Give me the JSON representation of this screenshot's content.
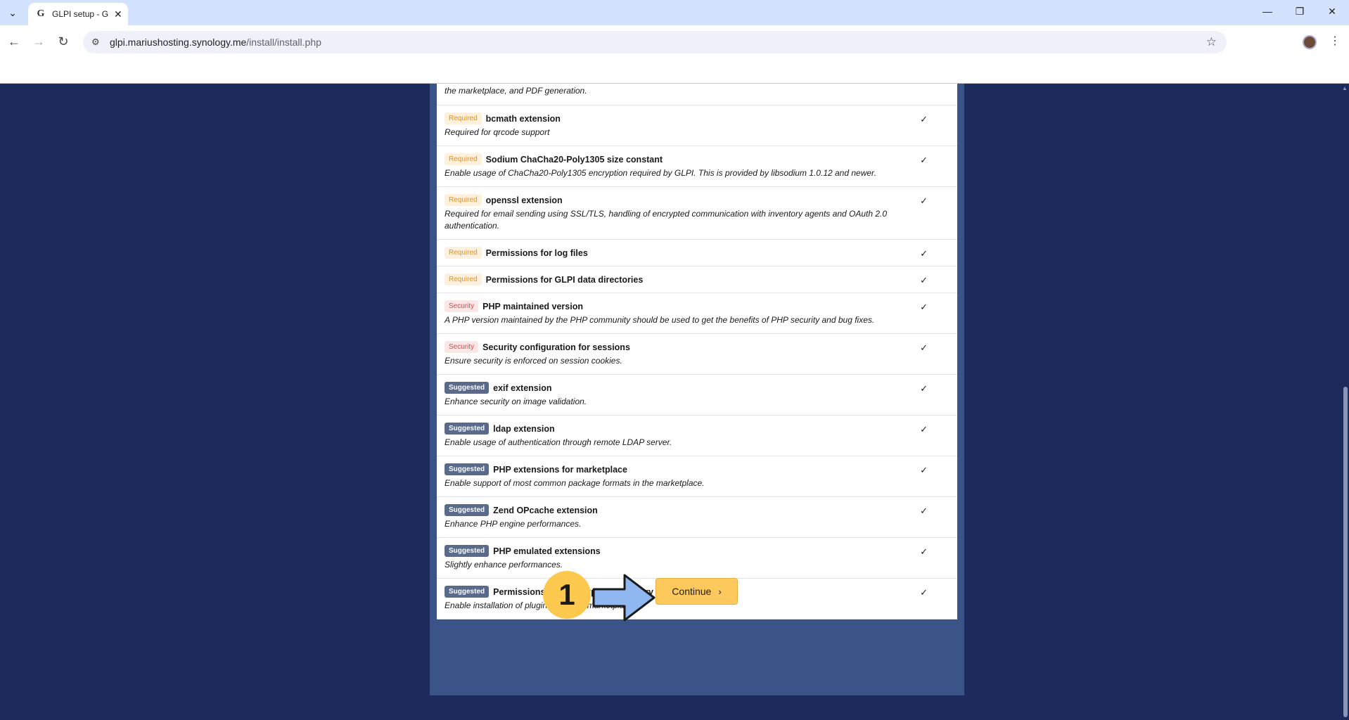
{
  "browser": {
    "tab_title": "GLPI setup - GLPI",
    "tab_favicon": "G",
    "url_host": "glpi.mariushosting.synology.me",
    "url_path": "/install/install.php"
  },
  "requirements": {
    "top_partial_desc": "the marketplace, and PDF generation.",
    "rows": [
      {
        "badge": "Required",
        "type": "required",
        "title": "bcmath extension",
        "desc": "Required for qrcode support"
      },
      {
        "badge": "Required",
        "type": "required",
        "title": "Sodium ChaCha20-Poly1305 size constant",
        "desc": "Enable usage of ChaCha20-Poly1305 encryption required by GLPI. This is provided by libsodium 1.0.12 and newer."
      },
      {
        "badge": "Required",
        "type": "required",
        "title": "openssl extension",
        "desc": "Required for email sending using SSL/TLS, handling of encrypted communication with inventory agents and OAuth 2.0 authentication."
      },
      {
        "badge": "Required",
        "type": "required",
        "title": "Permissions for log files",
        "desc": ""
      },
      {
        "badge": "Required",
        "type": "required",
        "title": "Permissions for GLPI data directories",
        "desc": ""
      },
      {
        "badge": "Security",
        "type": "security",
        "title": "PHP maintained version",
        "desc": "A PHP version maintained by the PHP community should be used to get the benefits of PHP security and bug fixes."
      },
      {
        "badge": "Security",
        "type": "security",
        "title": "Security configuration for sessions",
        "desc": "Ensure security is enforced on session cookies."
      },
      {
        "badge": "Suggested",
        "type": "suggested",
        "title": "exif extension",
        "desc": "Enhance security on image validation."
      },
      {
        "badge": "Suggested",
        "type": "suggested",
        "title": "ldap extension",
        "desc": "Enable usage of authentication through remote LDAP server."
      },
      {
        "badge": "Suggested",
        "type": "suggested",
        "title": "PHP extensions for marketplace",
        "desc": "Enable support of most common package formats in the marketplace."
      },
      {
        "badge": "Suggested",
        "type": "suggested",
        "title": "Zend OPcache extension",
        "desc": "Enhance PHP engine performances."
      },
      {
        "badge": "Suggested",
        "type": "suggested",
        "title": "PHP emulated extensions",
        "desc": "Slightly enhance performances."
      },
      {
        "badge": "Suggested",
        "type": "suggested",
        "title": "Permissions for marketplace directory",
        "desc": "Enable installation of plugins from the marketplace."
      }
    ],
    "check_glyph": "✓"
  },
  "actions": {
    "continue_label": "Continue"
  },
  "annotation": {
    "step_number": "1"
  },
  "colors": {
    "page_bg": "#1d2b5c",
    "panel_bg": "#3a5488",
    "continue_bg": "#fec95c",
    "required_badge": "#e8901a",
    "security_badge": "#d44a4a",
    "suggested_badge": "#5a6a8a"
  }
}
